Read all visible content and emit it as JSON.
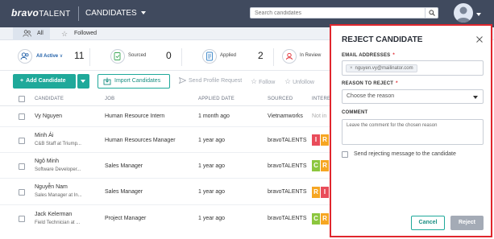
{
  "header": {
    "logo_part1": "bravo",
    "logo_part2": "TALENT",
    "module": "CANDIDATES",
    "search_placeholder": "Search candidates"
  },
  "tabs": [
    {
      "label": "All",
      "active": true
    },
    {
      "label": "Followed",
      "active": false
    }
  ],
  "stats": [
    {
      "label": "All Active",
      "value": "11"
    },
    {
      "label": "Sourced",
      "value": "0"
    },
    {
      "label": "Applied",
      "value": "2"
    },
    {
      "label": "In Review",
      "value": ""
    }
  ],
  "toolbar": {
    "add_label": "Add Candidate",
    "import_label": "Import Candidates",
    "send_label": "Send Profile Request",
    "follow_label": "Follow",
    "unfollow_label": "Unfollow"
  },
  "columns": [
    "CANDIDATE",
    "JOB",
    "APPLIED DATE",
    "SOURCED",
    "INTERE"
  ],
  "rows": [
    {
      "name": "Vy Nguyen",
      "subtitle": "",
      "job": "Human Resource Intern",
      "applied": "1 month ago",
      "source": "Vietnamworks",
      "interest_text": "Not in",
      "tags": []
    },
    {
      "name": "Minh Ái",
      "subtitle": "C&B Staff at Triump...",
      "job": "Human Resources Manager",
      "applied": "1 year ago",
      "source": "bravoTALENTS",
      "interest_text": "",
      "tags": [
        {
          "letter": "I",
          "color": "#e94c5a"
        },
        {
          "letter": "R",
          "color": "#f6a623"
        }
      ]
    },
    {
      "name": "Ngô Minh",
      "subtitle": "Software Developer...",
      "job": "Sales Manager",
      "applied": "1 year ago",
      "source": "bravoTALENTS",
      "interest_text": "",
      "tags": [
        {
          "letter": "C",
          "color": "#8cc63e"
        },
        {
          "letter": "R",
          "color": "#f6a623"
        }
      ]
    },
    {
      "name": "Nguyễn Nam",
      "subtitle": "Sales Manager at In...",
      "job": "Sales Manager",
      "applied": "1 year ago",
      "source": "bravoTALENTS",
      "interest_text": "",
      "tags": [
        {
          "letter": "R",
          "color": "#f6a623"
        },
        {
          "letter": "I",
          "color": "#e94c5a"
        }
      ]
    },
    {
      "name": "Jack Kelerman",
      "subtitle": "Field Technician at ...",
      "job": "Project Manager",
      "applied": "1 year ago",
      "source": "bravoTALENTS",
      "interest_text": "",
      "tags": [
        {
          "letter": "C",
          "color": "#8cc63e"
        },
        {
          "letter": "R",
          "color": "#f6a623"
        }
      ]
    }
  ],
  "modal": {
    "title": "REJECT CANDIDATE",
    "email_label": "EMAIL ADDRESSES",
    "required_mark": "*",
    "email_chip": "nguyen.vy@mailinator.com",
    "chip_remove": "×",
    "reason_label": "REASON TO REJECT",
    "reason_placeholder": "Choose the reason",
    "comment_label": "COMMENT",
    "comment_placeholder": "Leave the comment for the chosen reason",
    "send_message_label": "Send rejecting message to the candidate",
    "cancel_label": "Cancel",
    "reject_label": "Reject"
  },
  "colors": {
    "header_bg": "#404a5e",
    "accent": "#1fa99a",
    "modal_border": "#e0262d",
    "reject_disabled": "#a4abb6"
  }
}
